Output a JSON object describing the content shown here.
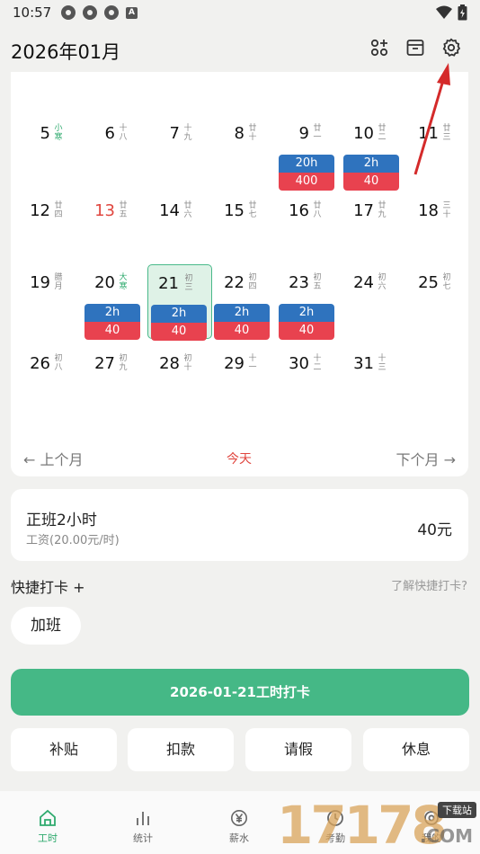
{
  "status_bar": {
    "time": "10:57",
    "a_badge": "A"
  },
  "header": {
    "title": "2026年01月"
  },
  "calendar": {
    "days": [
      {
        "num": "5",
        "lunar": "小寒",
        "lunar_green": true
      },
      {
        "num": "6",
        "lunar": "十八"
      },
      {
        "num": "7",
        "lunar": "十九"
      },
      {
        "num": "8",
        "lunar": "廿十"
      },
      {
        "num": "9",
        "lunar": "廿一",
        "hours": "20h",
        "amount": "400"
      },
      {
        "num": "10",
        "lunar": "廿二",
        "hours": "2h",
        "amount": "40"
      },
      {
        "num": "11",
        "lunar": "廿三"
      },
      {
        "num": "12",
        "lunar": "廿四"
      },
      {
        "num": "13",
        "lunar": "廿五",
        "red": true
      },
      {
        "num": "14",
        "lunar": "廿六"
      },
      {
        "num": "15",
        "lunar": "廿七"
      },
      {
        "num": "16",
        "lunar": "廿八"
      },
      {
        "num": "17",
        "lunar": "廿九"
      },
      {
        "num": "18",
        "lunar": "三十"
      },
      {
        "num": "19",
        "lunar": "腊月"
      },
      {
        "num": "20",
        "lunar": "大寒",
        "lunar_green": true,
        "hours": "2h",
        "amount": "40"
      },
      {
        "num": "21",
        "lunar": "初三",
        "selected": true,
        "hours": "2h",
        "amount": "40"
      },
      {
        "num": "22",
        "lunar": "初四",
        "hours": "2h",
        "amount": "40"
      },
      {
        "num": "23",
        "lunar": "初五",
        "hours": "2h",
        "amount": "40"
      },
      {
        "num": "24",
        "lunar": "初六"
      },
      {
        "num": "25",
        "lunar": "初七"
      },
      {
        "num": "26",
        "lunar": "初八"
      },
      {
        "num": "27",
        "lunar": "初九"
      },
      {
        "num": "28",
        "lunar": "初十"
      },
      {
        "num": "29",
        "lunar": "十一"
      },
      {
        "num": "30",
        "lunar": "十二"
      },
      {
        "num": "31",
        "lunar": "十三"
      }
    ],
    "prev_label": "← 上个月",
    "today_label": "今天",
    "next_label": "下个月 →"
  },
  "summary": {
    "title": "正班2小时",
    "subtitle": "工资(20.00元/时)",
    "amount": "40元"
  },
  "quick": {
    "label": "快捷打卡 +",
    "help": "了解快捷打卡?",
    "overtime": "加班"
  },
  "punch_button": "2026-01-21工时打卡",
  "actions": [
    "补贴",
    "扣款",
    "请假",
    "休息"
  ],
  "tabs": [
    {
      "label": "工时",
      "icon": "home-icon"
    },
    {
      "label": "统计",
      "icon": "bar-chart-icon"
    },
    {
      "label": "薪水",
      "icon": "yen-icon"
    },
    {
      "label": "考勤",
      "icon": "clock-icon"
    },
    {
      "label": "我的",
      "icon": "settings-icon"
    }
  ],
  "watermark": {
    "number": "17178",
    "tag": "下载站",
    "domain": ".COM"
  },
  "colors": {
    "accent": "#45b886",
    "hours_blue": "#2f73be",
    "amount_red": "#e8424f",
    "holiday_red": "#e0463f"
  }
}
